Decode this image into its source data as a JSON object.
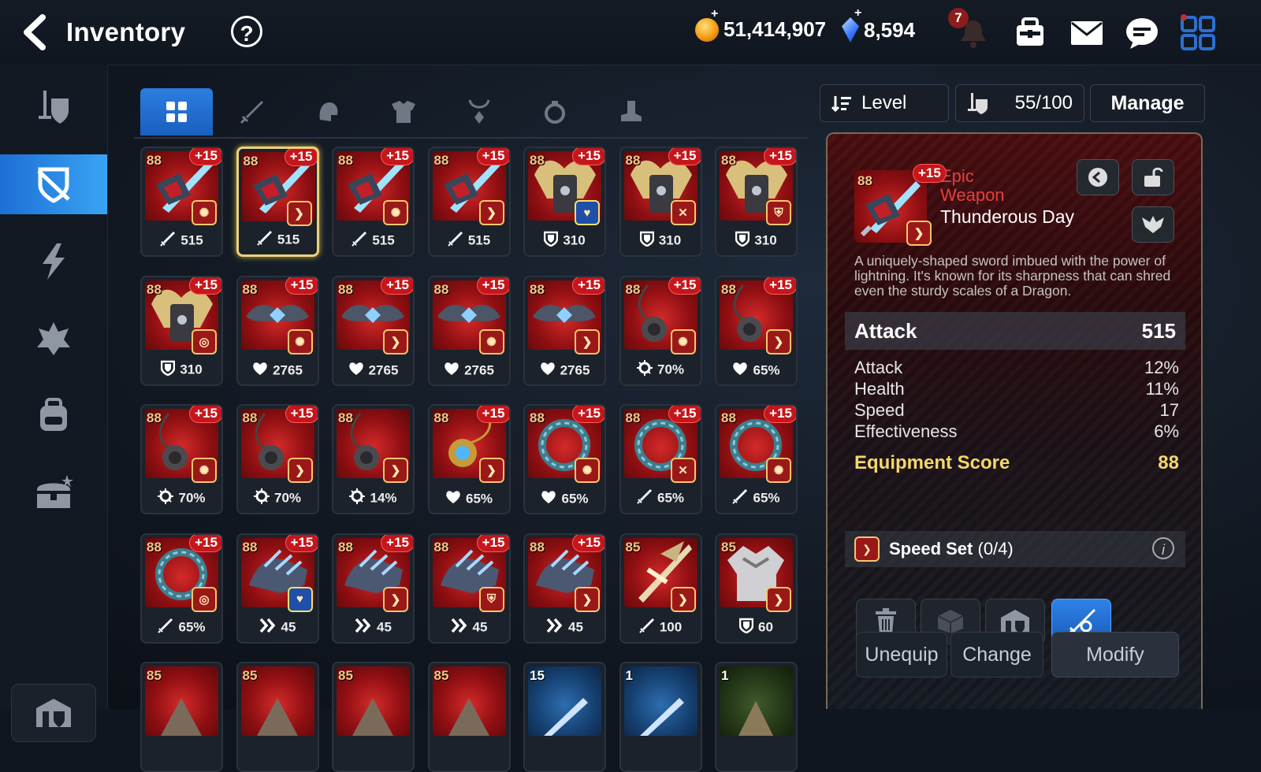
{
  "header": {
    "title": "Inventory",
    "help_label": "?",
    "gold": "51,414,907",
    "crystals": "8,594",
    "notification_count": "7"
  },
  "tabs": [
    "all",
    "weapon",
    "helmet",
    "armor",
    "necklace",
    "ring",
    "boots"
  ],
  "controls": {
    "sort_label": "Level",
    "capacity": "55/100",
    "manage_label": "Manage"
  },
  "items": [
    {
      "level": "88",
      "enh": "+15",
      "kind": "weapon",
      "set": "attack",
      "stat": "515",
      "stat_icon": "attack"
    },
    {
      "level": "88",
      "enh": "+15",
      "kind": "weapon",
      "set": "speed",
      "stat": "515",
      "stat_icon": "attack",
      "selected": true
    },
    {
      "level": "88",
      "enh": "+15",
      "kind": "weapon",
      "set": "attack",
      "stat": "515",
      "stat_icon": "attack"
    },
    {
      "level": "88",
      "enh": "+15",
      "kind": "weapon",
      "set": "speed",
      "stat": "515",
      "stat_icon": "attack"
    },
    {
      "level": "88",
      "enh": "+15",
      "kind": "armor",
      "set": "health",
      "stat": "310",
      "stat_icon": "defense"
    },
    {
      "level": "88",
      "enh": "+15",
      "kind": "armor",
      "set": "counter",
      "stat": "310",
      "stat_icon": "defense"
    },
    {
      "level": "88",
      "enh": "+15",
      "kind": "armor",
      "set": "defense",
      "stat": "310",
      "stat_icon": "defense"
    },
    {
      "level": "88",
      "enh": "+15",
      "kind": "armor",
      "set": "critical",
      "stat": "310",
      "stat_icon": "defense"
    },
    {
      "level": "88",
      "enh": "+15",
      "kind": "helmet",
      "set": "attack",
      "stat": "2765",
      "stat_icon": "health"
    },
    {
      "level": "88",
      "enh": "+15",
      "kind": "helmet",
      "set": "speed",
      "stat": "2765",
      "stat_icon": "health"
    },
    {
      "level": "88",
      "enh": "+15",
      "kind": "helmet",
      "set": "attack",
      "stat": "2765",
      "stat_icon": "health"
    },
    {
      "level": "88",
      "enh": "+15",
      "kind": "helmet",
      "set": "speed",
      "stat": "2765",
      "stat_icon": "health"
    },
    {
      "level": "88",
      "enh": "+15",
      "kind": "necklace",
      "set": "attack",
      "stat": "70%",
      "stat_icon": "crit"
    },
    {
      "level": "88",
      "enh": "+15",
      "kind": "necklace",
      "set": "speed",
      "stat": "65%",
      "stat_icon": "health"
    },
    {
      "level": "88",
      "enh": "+15",
      "kind": "necklace",
      "set": "attack",
      "stat": "70%",
      "stat_icon": "crit"
    },
    {
      "level": "88",
      "enh": "+15",
      "kind": "necklace",
      "set": "speed",
      "stat": "70%",
      "stat_icon": "crit"
    },
    {
      "level": "88",
      "enh": "",
      "kind": "necklace",
      "set": "speed",
      "stat": "14%",
      "stat_icon": "crit"
    },
    {
      "level": "88",
      "enh": "+15",
      "kind": "necklace-gold",
      "set": "speed",
      "stat": "65%",
      "stat_icon": "health"
    },
    {
      "level": "88",
      "enh": "+15",
      "kind": "ring",
      "set": "attack",
      "stat": "65%",
      "stat_icon": "health"
    },
    {
      "level": "88",
      "enh": "+15",
      "kind": "ring",
      "set": "counter",
      "stat": "65%",
      "stat_icon": "attack"
    },
    {
      "level": "88",
      "enh": "+15",
      "kind": "ring",
      "set": "attack",
      "stat": "65%",
      "stat_icon": "attack"
    },
    {
      "level": "88",
      "enh": "+15",
      "kind": "ring",
      "set": "critical",
      "stat": "65%",
      "stat_icon": "attack"
    },
    {
      "level": "88",
      "enh": "+15",
      "kind": "boots",
      "set": "health",
      "stat": "45",
      "stat_icon": "speed"
    },
    {
      "level": "88",
      "enh": "+15",
      "kind": "boots",
      "set": "speed",
      "stat": "45",
      "stat_icon": "speed"
    },
    {
      "level": "88",
      "enh": "+15",
      "kind": "boots",
      "set": "defense",
      "stat": "45",
      "stat_icon": "speed"
    },
    {
      "level": "88",
      "enh": "+15",
      "kind": "boots",
      "set": "speed",
      "stat": "45",
      "stat_icon": "speed"
    },
    {
      "level": "85",
      "enh": "",
      "kind": "weapon-gold",
      "set": "speed",
      "stat": "100",
      "stat_icon": "attack"
    },
    {
      "level": "85",
      "enh": "",
      "kind": "armor-silver",
      "set": "speed",
      "stat": "60",
      "stat_icon": "defense"
    },
    {
      "level": "85",
      "enh": "",
      "kind": "partial",
      "set": "",
      "stat": "",
      "stat_icon": ""
    },
    {
      "level": "85",
      "enh": "",
      "kind": "partial",
      "set": "",
      "stat": "",
      "stat_icon": ""
    },
    {
      "level": "85",
      "enh": "",
      "kind": "partial",
      "set": "",
      "stat": "",
      "stat_icon": ""
    },
    {
      "level": "85",
      "enh": "",
      "kind": "partial",
      "set": "",
      "stat": "",
      "stat_icon": ""
    },
    {
      "level": "15",
      "enh": "",
      "kind": "partial-blue",
      "set": "",
      "stat": "",
      "stat_icon": ""
    },
    {
      "level": "1",
      "enh": "",
      "kind": "partial-blue",
      "set": "",
      "stat": "",
      "stat_icon": ""
    },
    {
      "level": "1",
      "enh": "",
      "kind": "partial-green",
      "set": "",
      "stat": "",
      "stat_icon": ""
    }
  ],
  "detail": {
    "level": "88",
    "enh": "+15",
    "rarity_line1": "Epic",
    "rarity_line2": "Weapon",
    "name": "Thunderous Day",
    "description": "A uniquely-shaped sword imbued with the power of lightning. It's known for its sharpness that can shred even the sturdy scales of a Dragon.",
    "main_stat_label": "Attack",
    "main_stat_value": "515",
    "substats": [
      {
        "label": "Attack",
        "value": "12%"
      },
      {
        "label": "Health",
        "value": "11%"
      },
      {
        "label": "Speed",
        "value": "17"
      },
      {
        "label": "Effectiveness",
        "value": "6%"
      }
    ],
    "score_label": "Equipment Score",
    "score_value": "88",
    "set_label": "Speed Set",
    "set_count": "(0/4)",
    "actions": {
      "unequip": "Unequip",
      "change": "Change",
      "modify": "Modify"
    }
  },
  "colors": {
    "accent": "#2b7ee0",
    "epic": "#e54040",
    "score": "#f4d76b",
    "item_bg": "#8f0f12"
  }
}
